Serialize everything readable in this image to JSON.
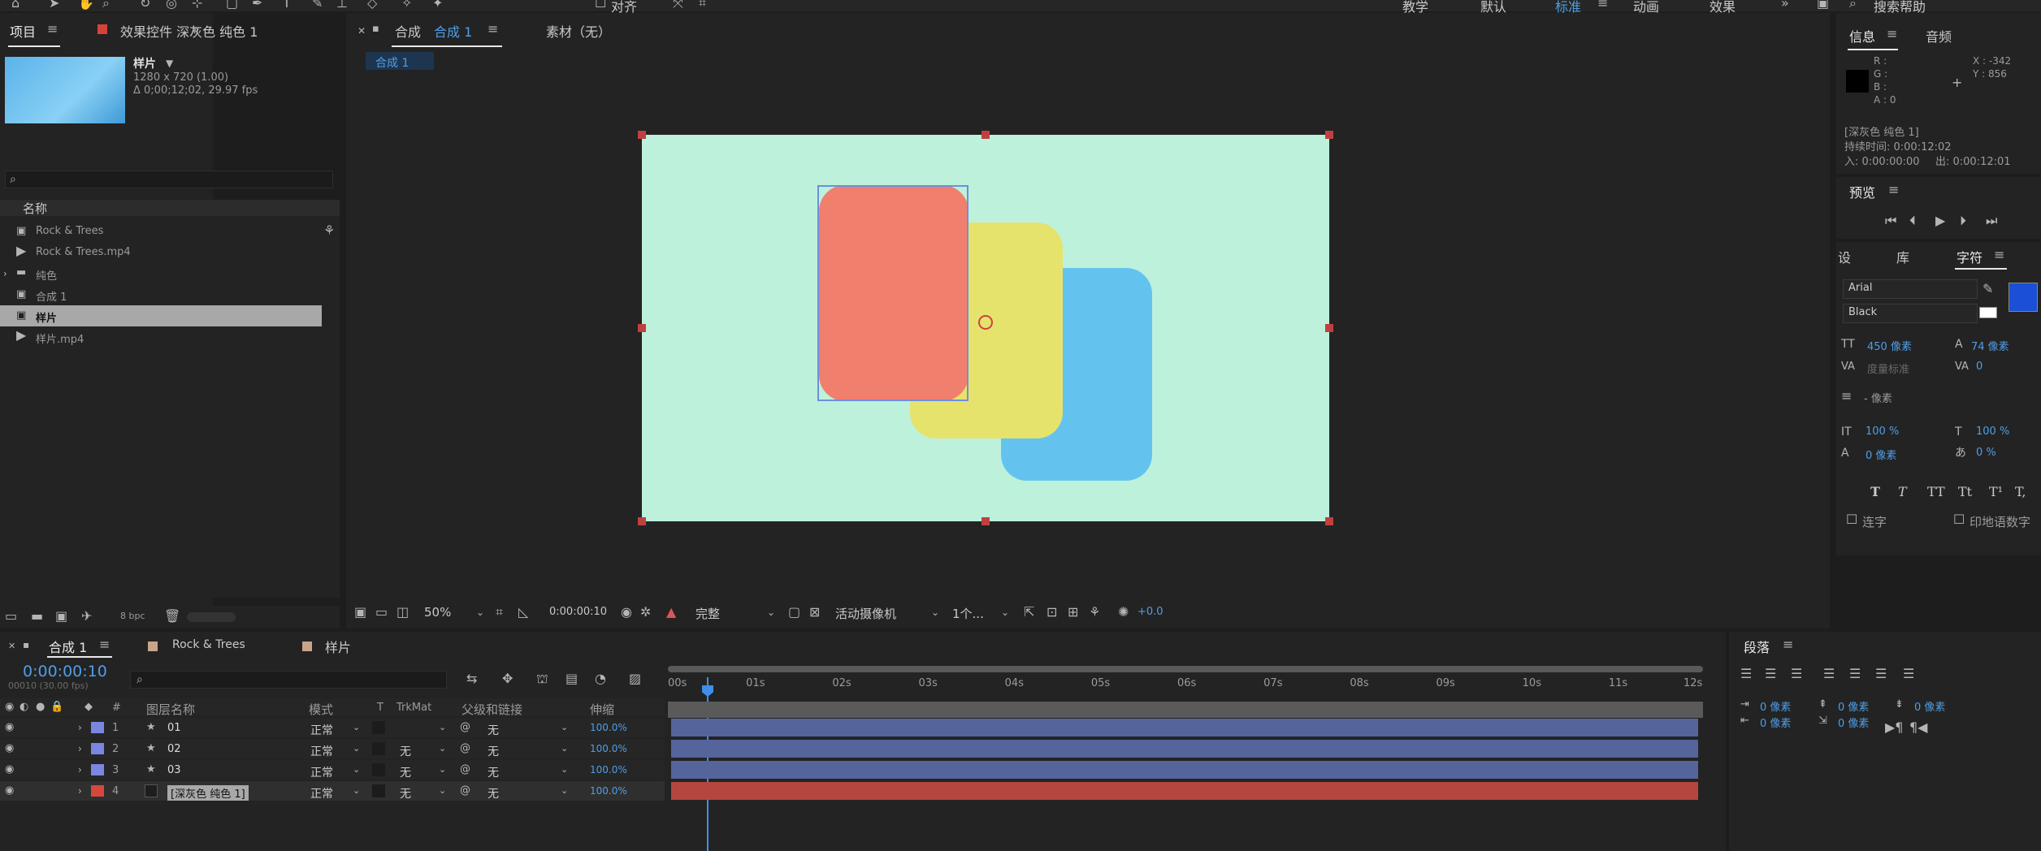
{
  "topbar": {
    "align": "对齐",
    "workspaces": [
      "教学",
      "默认",
      "标准",
      "动画",
      "效果"
    ],
    "search": "搜索帮助"
  },
  "project_panel": {
    "tabs": [
      "项目",
      "效果控件 深灰色 纯色 1"
    ],
    "selected_name": "样片",
    "resolution": "1280 x 720 (1.00)",
    "duration": "Δ 0;00;12;02, 29.97 fps",
    "column_name": "名称",
    "items": [
      "Rock & Trees",
      "Rock & Trees.mp4",
      "纯色",
      "合成 1",
      "样片",
      "样片.mp4"
    ],
    "bpc": "8 bpc"
  },
  "comp_viewer": {
    "tab_prefix": "合成",
    "tab_name": "合成 1",
    "footage_tab": "素材（无）",
    "breadcrumb": "合成 1",
    "zoom": "50%",
    "timecode": "0:00:00:10",
    "quality": "完整",
    "camera": "活动摄像机",
    "views": "1个...",
    "exposure": "+0.0"
  },
  "info_panel": {
    "tabs": [
      "信息",
      "音频"
    ],
    "r": "R :",
    "g": "G :",
    "b": "B :",
    "a": "A : 0",
    "x": "X : -342",
    "y": "Y : 856",
    "layer_name": "[深灰色 纯色 1]",
    "duration": "持续时间: 0:00:12:02",
    "in": "入: 0:00:00:00",
    "out": "出: 0:00:12:01"
  },
  "preview_panel": {
    "title": "预览"
  },
  "character_panel": {
    "tabs": [
      "设",
      "库",
      "字符"
    ],
    "font": "Arial",
    "style": "Black",
    "size": "450 像素",
    "leading": "74 像素",
    "kerning": "度量标准",
    "tracking": "0",
    "stroke": "- 像素",
    "vscale": "100 %",
    "hscale": "100 %",
    "baseline": "0 像素",
    "tsume": "0 %",
    "styles": [
      "T",
      "T",
      "TT",
      "Tt",
      "T¹",
      "T,"
    ],
    "ligature": "连字",
    "hindi": "印地语数字",
    "fill_color": "#1a4fd6"
  },
  "timeline": {
    "tabs": [
      "合成 1",
      "Rock & Trees",
      "样片"
    ],
    "timecode": "0:00:00:10",
    "fps": "00010 (30.00 fps)",
    "columns": [
      "图层名称",
      "模式",
      "T",
      "TrkMat",
      "父级和链接",
      "伸缩"
    ],
    "ruler": [
      "00s",
      "01s",
      "02s",
      "03s",
      "04s",
      "05s",
      "06s",
      "07s",
      "08s",
      "09s",
      "10s",
      "11s",
      "12s"
    ],
    "layers": [
      {
        "num": "1",
        "name": "01",
        "mode": "正常",
        "trkmat": "",
        "parent": "无",
        "stretch": "100.0%",
        "color": "#7a86e0"
      },
      {
        "num": "2",
        "name": "02",
        "mode": "正常",
        "trkmat": "无",
        "parent": "无",
        "stretch": "100.0%",
        "color": "#7a86e0"
      },
      {
        "num": "3",
        "name": "03",
        "mode": "正常",
        "trkmat": "无",
        "parent": "无",
        "stretch": "100.0%",
        "color": "#7a86e0"
      },
      {
        "num": "4",
        "name": "[深灰色 纯色 1]",
        "mode": "正常",
        "trkmat": "无",
        "parent": "无",
        "stretch": "100.0%",
        "color": "#d6483c"
      }
    ]
  },
  "paragraph_panel": {
    "title": "段落",
    "indent_left": "0 像素",
    "indent_right": "0 像素",
    "space_before": "0 像素",
    "first_line": "0 像素",
    "space_after": "0 像素"
  },
  "canvas": {
    "bg": "#bdf1dc",
    "shapes": [
      {
        "name": "blue",
        "color": "#63c3ee"
      },
      {
        "name": "yellow",
        "color": "#e6e36c"
      },
      {
        "name": "red",
        "color": "#f07f6e"
      }
    ]
  }
}
